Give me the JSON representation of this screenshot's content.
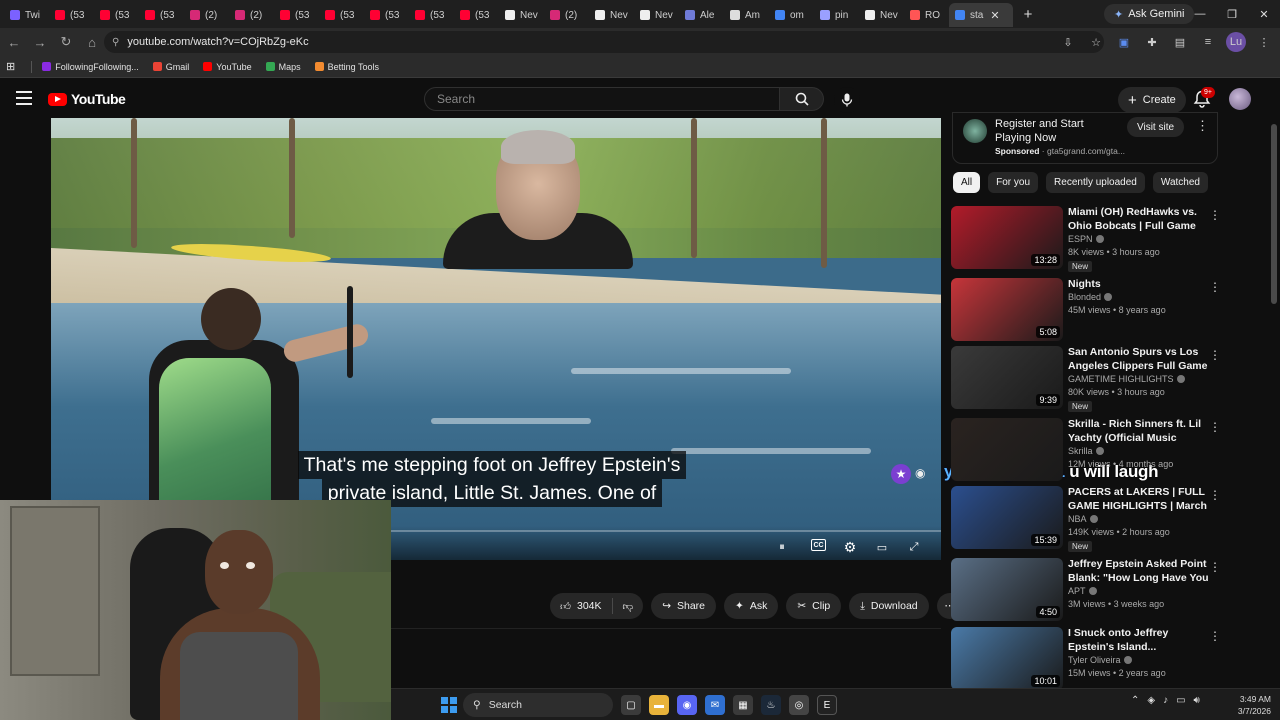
{
  "browser": {
    "tabs": [
      {
        "label": "Twi",
        "color": "#7b61ff"
      },
      {
        "label": "(53",
        "color": "#ff0033"
      },
      {
        "label": "(53",
        "color": "#ff0033"
      },
      {
        "label": "(53",
        "color": "#ff0033"
      },
      {
        "label": "(2)",
        "color": "#d62976"
      },
      {
        "label": "(2)",
        "color": "#d62976"
      },
      {
        "label": "(53",
        "color": "#ff0033"
      },
      {
        "label": "(53",
        "color": "#ff0033"
      },
      {
        "label": "(53",
        "color": "#ff0033"
      },
      {
        "label": "(53",
        "color": "#ff0033"
      },
      {
        "label": "(53",
        "color": "#ff0033"
      },
      {
        "label": "Nev",
        "color": "#eeeeee"
      },
      {
        "label": "(2)",
        "color": "#d62976"
      },
      {
        "label": "Nev",
        "color": "#eeeeee"
      },
      {
        "label": "Nev",
        "color": "#eeeeee"
      },
      {
        "label": "Ale",
        "color": "#6f7bd8"
      },
      {
        "label": "Am",
        "color": "#dddddd"
      },
      {
        "label": "om",
        "color": "#4285f4"
      },
      {
        "label": "pin",
        "color": "#9aa0ff"
      },
      {
        "label": "Nev",
        "color": "#eeeeee"
      },
      {
        "label": "RO",
        "color": "#ff5555"
      },
      {
        "label": "sta",
        "color": "#4285f4"
      }
    ],
    "active_tab_close": "✕",
    "new_tab": "+",
    "ask_gemini": "Ask Gemini",
    "url": "youtube.com/watch?v=COjRbZg-eKc",
    "profile_initials": "Lu",
    "bookmarks": [
      {
        "label": "FollowingFollowing...",
        "color": "#8a2be2"
      },
      {
        "label": "Gmail",
        "color": "#ea4335"
      },
      {
        "label": "YouTube",
        "color": "#ff0000"
      },
      {
        "label": "Maps",
        "color": "#34a853"
      },
      {
        "label": "Betting Tools",
        "color": "#f28b30"
      }
    ]
  },
  "youtube": {
    "logo_text": "YouTube",
    "search_placeholder": "Search",
    "create_label": "Create",
    "notifications_badge": "9+"
  },
  "video": {
    "caption_line1": "That's me stepping foot on Jeffrey Epstein's",
    "caption_line2": "private island, Little St. James. One of",
    "actions": {
      "likes": "304K",
      "share": "Share",
      "ask": "Ask",
      "clip": "Clip",
      "download": "Download"
    }
  },
  "stream_overlay": {
    "username": "yuhtravgames1",
    "message": "u will laugh"
  },
  "sidebar": {
    "ad": {
      "title": "Register and Start Playing Now",
      "sponsored": "Sponsored",
      "domain": "gta5grand.com/gta...",
      "visit": "Visit site"
    },
    "chips": [
      "All",
      "For you",
      "Recently uploaded",
      "Watched"
    ],
    "recommendations": [
      {
        "title": "Miami (OH) RedHawks vs. Ohio Bobcats | Full Game Highlights...",
        "channel": "ESPN",
        "meta": "8K views • 3 hours ago",
        "new": "New",
        "duration": "13:28",
        "thumb": "#b31b2a"
      },
      {
        "title": "Nights",
        "channel": "Blonded",
        "meta": "45M views • 8 years ago",
        "new": "",
        "duration": "5:08",
        "thumb": "#c7353a"
      },
      {
        "title": "San Antonio Spurs vs Los Angeles Clippers Full Game ...",
        "channel": "GAMETIME HIGHLIGHTS",
        "meta": "80K views • 3 hours ago",
        "new": "New",
        "duration": "9:39",
        "thumb": "#3a3a3a"
      },
      {
        "title": "Skrilla - Rich Sinners ft. Lil Yachty (Official Music Video)",
        "channel": "Skrilla",
        "meta": "12M views • 4 months ago",
        "new": "",
        "duration": "",
        "thumb": "#2a2320"
      },
      {
        "title": "PACERS at LAKERS | FULL GAME HIGHLIGHTS | March 6, ...",
        "channel": "NBA",
        "meta": "149K views • 2 hours ago",
        "new": "New",
        "duration": "15:39",
        "thumb": "#2b4f8f"
      },
      {
        "title": "Jeffrey Epstein Asked Point Blank: \"How Long Have You ...",
        "channel": "APT",
        "meta": "3M views • 3 weeks ago",
        "new": "",
        "duration": "4:50",
        "thumb": "#5a6f86"
      },
      {
        "title": "I Snuck onto Jeffrey Epstein's Island...",
        "channel": "Tyler Oliveira",
        "meta": "15M views • 2 years ago",
        "new": "",
        "duration": "10:01",
        "thumb": "#4a7aa8"
      }
    ]
  },
  "taskbar": {
    "search": "Search",
    "time": "3:49 AM",
    "date": "3/7/2026"
  }
}
